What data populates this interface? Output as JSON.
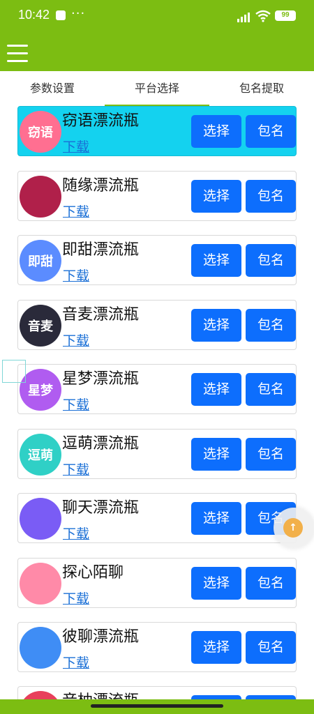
{
  "status": {
    "time": "10:42",
    "dots": "···",
    "battery": "99"
  },
  "tabs": [
    {
      "label": "参数设置"
    },
    {
      "label": "平台选择"
    },
    {
      "label": "包名提取"
    }
  ],
  "buttons": {
    "select_label": "选择",
    "package_label": "包名"
  },
  "items": [
    {
      "name": "窃语漂流瓶",
      "download": "下载",
      "logo_text": "窃语",
      "logo_color": "#ff6f91"
    },
    {
      "name": "随缘漂流瓶",
      "download": "下载",
      "logo_text": "",
      "logo_color": "#b0204a"
    },
    {
      "name": "即甜漂流瓶",
      "download": "下载",
      "logo_text": "即甜",
      "logo_color": "#5b8cff"
    },
    {
      "name": "音麦漂流瓶",
      "download": "下载",
      "logo_text": "音麦",
      "logo_color": "#2a2a3a"
    },
    {
      "name": "星梦漂流瓶",
      "download": "下载",
      "logo_text": "星梦",
      "logo_color": "#b05cf0"
    },
    {
      "name": "逗萌漂流瓶",
      "download": "下载",
      "logo_text": "逗萌",
      "logo_color": "#2fd0c6"
    },
    {
      "name": "聊天漂流瓶",
      "download": "下载",
      "logo_text": "",
      "logo_color": "#7a5cf5"
    },
    {
      "name": "探心陌聊",
      "download": "下载",
      "logo_text": "",
      "logo_color": "#ff8aa8"
    },
    {
      "name": "彼聊漂流瓶",
      "download": "下载",
      "logo_text": "",
      "logo_color": "#3f8df5"
    },
    {
      "name": "音柚漂流瓶",
      "download": "",
      "logo_text": "",
      "logo_color": "#e83f5b"
    }
  ],
  "colors": {
    "accent": "#7cbd12",
    "button": "#0d6efd",
    "highlight": "#14d2ef",
    "link": "#1a6fd6"
  }
}
